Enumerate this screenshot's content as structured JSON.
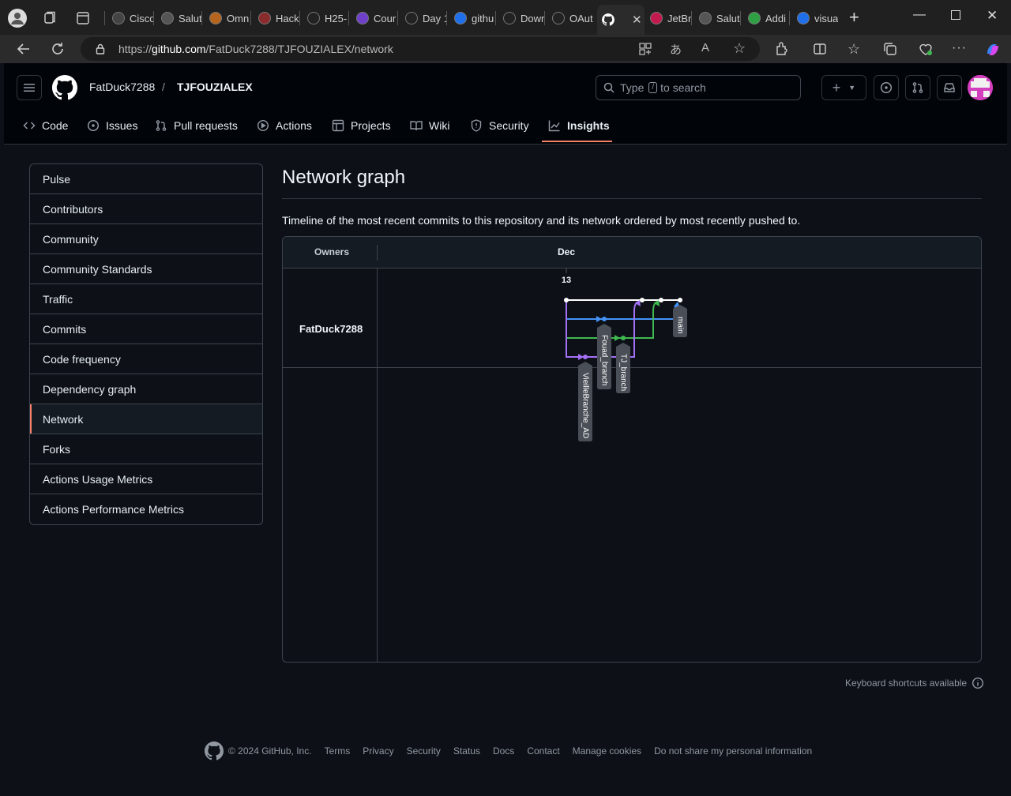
{
  "browser": {
    "tabs": [
      {
        "label": "Cisco"
      },
      {
        "label": "Salut"
      },
      {
        "label": "Omn"
      },
      {
        "label": "Hack"
      },
      {
        "label": "H25-"
      },
      {
        "label": "Cour"
      },
      {
        "label": "Day 1"
      },
      {
        "label": "githu"
      },
      {
        "label": "Dowr"
      },
      {
        "label": "OAut"
      },
      {
        "label": ""
      },
      {
        "label": "JetBr"
      },
      {
        "label": "Salut"
      },
      {
        "label": "Addi"
      },
      {
        "label": "visua"
      }
    ],
    "url_prefix": "https://",
    "url_host": "github.com",
    "url_path": "/FatDuck7288/TJFOUZIALEX/network"
  },
  "header": {
    "owner": "FatDuck7288",
    "separator": "/",
    "repo": "TJFOUZIALEX",
    "search_prefix": "Type",
    "search_key": "/",
    "search_suffix": "to search"
  },
  "repo_nav": [
    {
      "label": "Code",
      "icon": "code-icon"
    },
    {
      "label": "Issues",
      "icon": "issue-icon"
    },
    {
      "label": "Pull requests",
      "icon": "pull-request-icon"
    },
    {
      "label": "Actions",
      "icon": "actions-icon"
    },
    {
      "label": "Projects",
      "icon": "projects-icon"
    },
    {
      "label": "Wiki",
      "icon": "wiki-icon"
    },
    {
      "label": "Security",
      "icon": "shield-icon"
    },
    {
      "label": "Insights",
      "icon": "graph-icon"
    }
  ],
  "sidebar": {
    "items": [
      {
        "label": "Pulse"
      },
      {
        "label": "Contributors"
      },
      {
        "label": "Community"
      },
      {
        "label": "Community Standards"
      },
      {
        "label": "Traffic"
      },
      {
        "label": "Commits"
      },
      {
        "label": "Code frequency"
      },
      {
        "label": "Dependency graph"
      },
      {
        "label": "Network"
      },
      {
        "label": "Forks"
      },
      {
        "label": "Actions Usage Metrics"
      },
      {
        "label": "Actions Performance Metrics"
      }
    ],
    "selected": "Network"
  },
  "main": {
    "title": "Network graph",
    "description": "Timeline of the most recent commits to this repository and its network ordered by most recently pushed to."
  },
  "network": {
    "owners_header": "Owners",
    "month": "Dec",
    "day": "13",
    "owner": "FatDuck7288",
    "branches": [
      {
        "name": "main",
        "color": "#ffffff"
      },
      {
        "name": "Fouad_branch",
        "color": "#4493f8"
      },
      {
        "name": "TJ_branch",
        "color": "#3fb950"
      },
      {
        "name": "VieilleBranche_AD",
        "color": "#a371f7"
      }
    ]
  },
  "footer": {
    "kbd_hint": "Keyboard shortcuts available",
    "copyright": "© 2024 GitHub, Inc.",
    "links": [
      "Terms",
      "Privacy",
      "Security",
      "Status",
      "Docs",
      "Contact",
      "Manage cookies",
      "Do not share my personal information"
    ]
  },
  "colors": {
    "accent": "#f78166",
    "background": "#0d1117",
    "header": "#010409",
    "border": "#3d444d"
  }
}
